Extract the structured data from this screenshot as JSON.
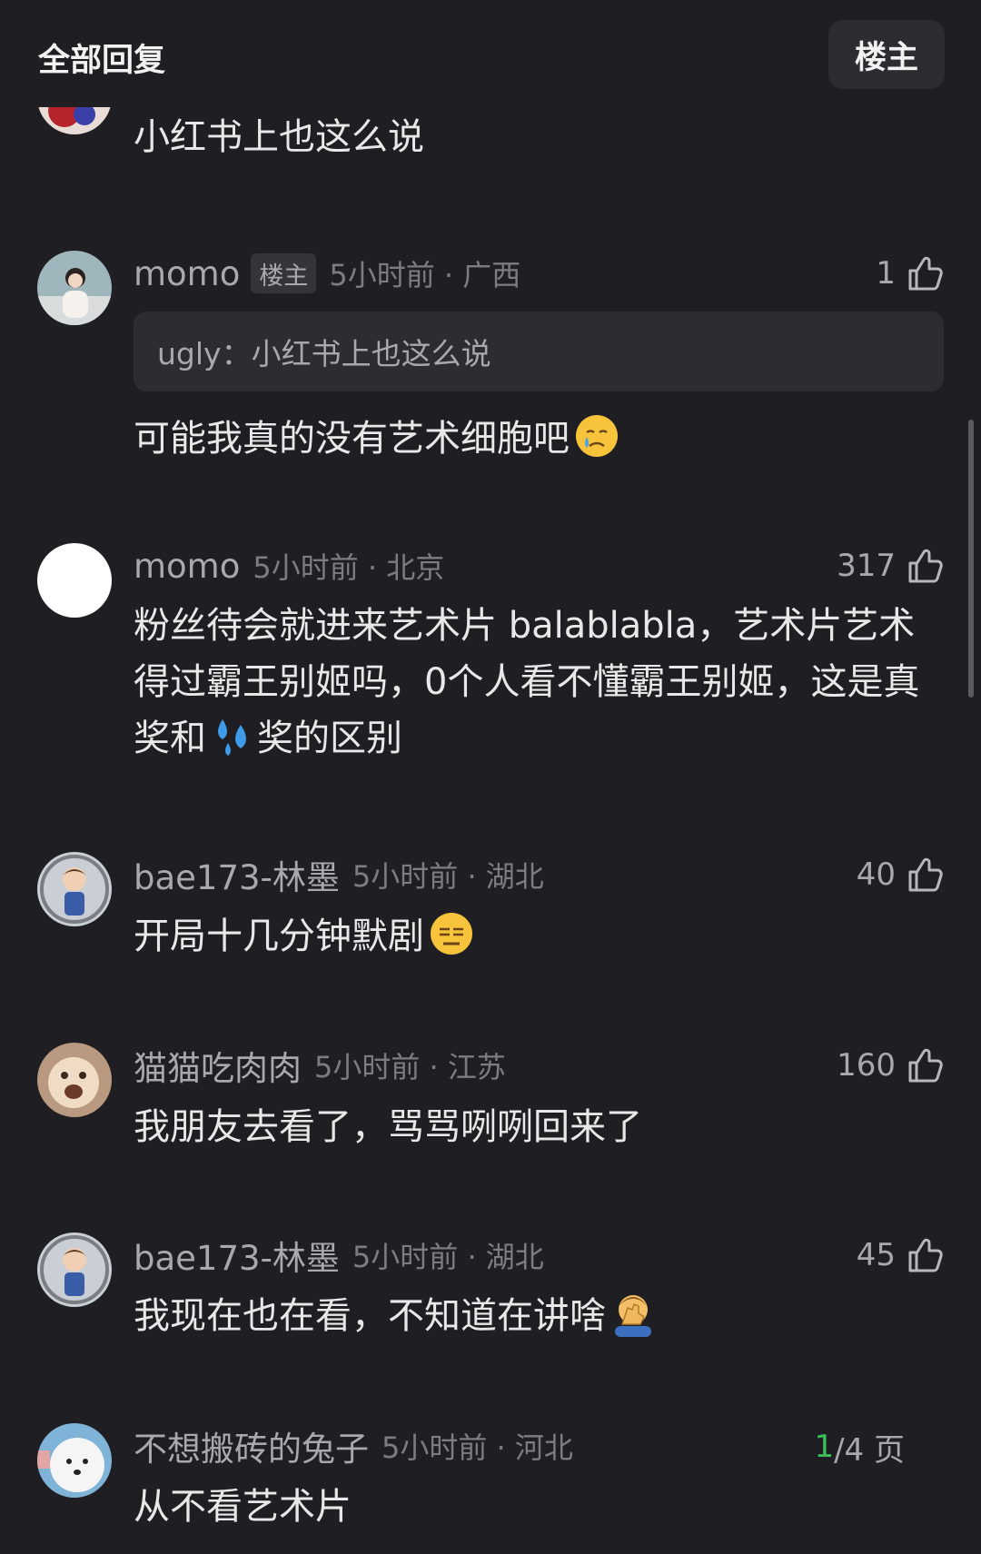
{
  "header": {
    "title": "全部回复",
    "op_button": "楼主"
  },
  "comments": [
    {
      "text": "小红书上也这么说"
    },
    {
      "username": "momo",
      "badge": "楼主",
      "time_location": "5小时前 · 广西",
      "likes": "1",
      "quote_user": "ugly",
      "quote_sep": "：",
      "quote_text": "小红书上也这么说",
      "text": "可能我真的没有艺术细胞吧",
      "emoji": "crying-face-emoji"
    },
    {
      "username": "momo",
      "time_location": "5小时前 · 北京",
      "likes": "317",
      "text_part1": "粉丝待会就进来艺术片 balablabla，艺术片艺术得过霸王别姬吗，0个人看不懂霸王别姬，这是真奖和",
      "emoji": "sweat-droplets-emoji",
      "text_part2": "奖的区别"
    },
    {
      "username": "bae173-林墨",
      "time_location": "5小时前 · 湖北",
      "likes": "40",
      "text": "开局十几分钟默剧",
      "emoji": "expressionless-face-emoji"
    },
    {
      "username": "猫猫吃肉肉",
      "time_location": "5小时前 · 江苏",
      "likes": "160",
      "text": "我朋友去看了，骂骂咧咧回来了"
    },
    {
      "username": "bae173-林墨",
      "time_location": "5小时前 · 湖北",
      "likes": "45",
      "text": "我现在也在看，不知道在讲啥",
      "emoji": "facepalm-emoji"
    },
    {
      "username": "不想搬砖的兔子",
      "time_location": "5小时前 · 河北",
      "text": "从不看艺术片"
    }
  ],
  "pager": {
    "current": "1",
    "total": "/4 页"
  },
  "colors": {
    "background": "#1f1f23",
    "accent_green": "#3fbf5a",
    "muted": "#7c7c81"
  }
}
